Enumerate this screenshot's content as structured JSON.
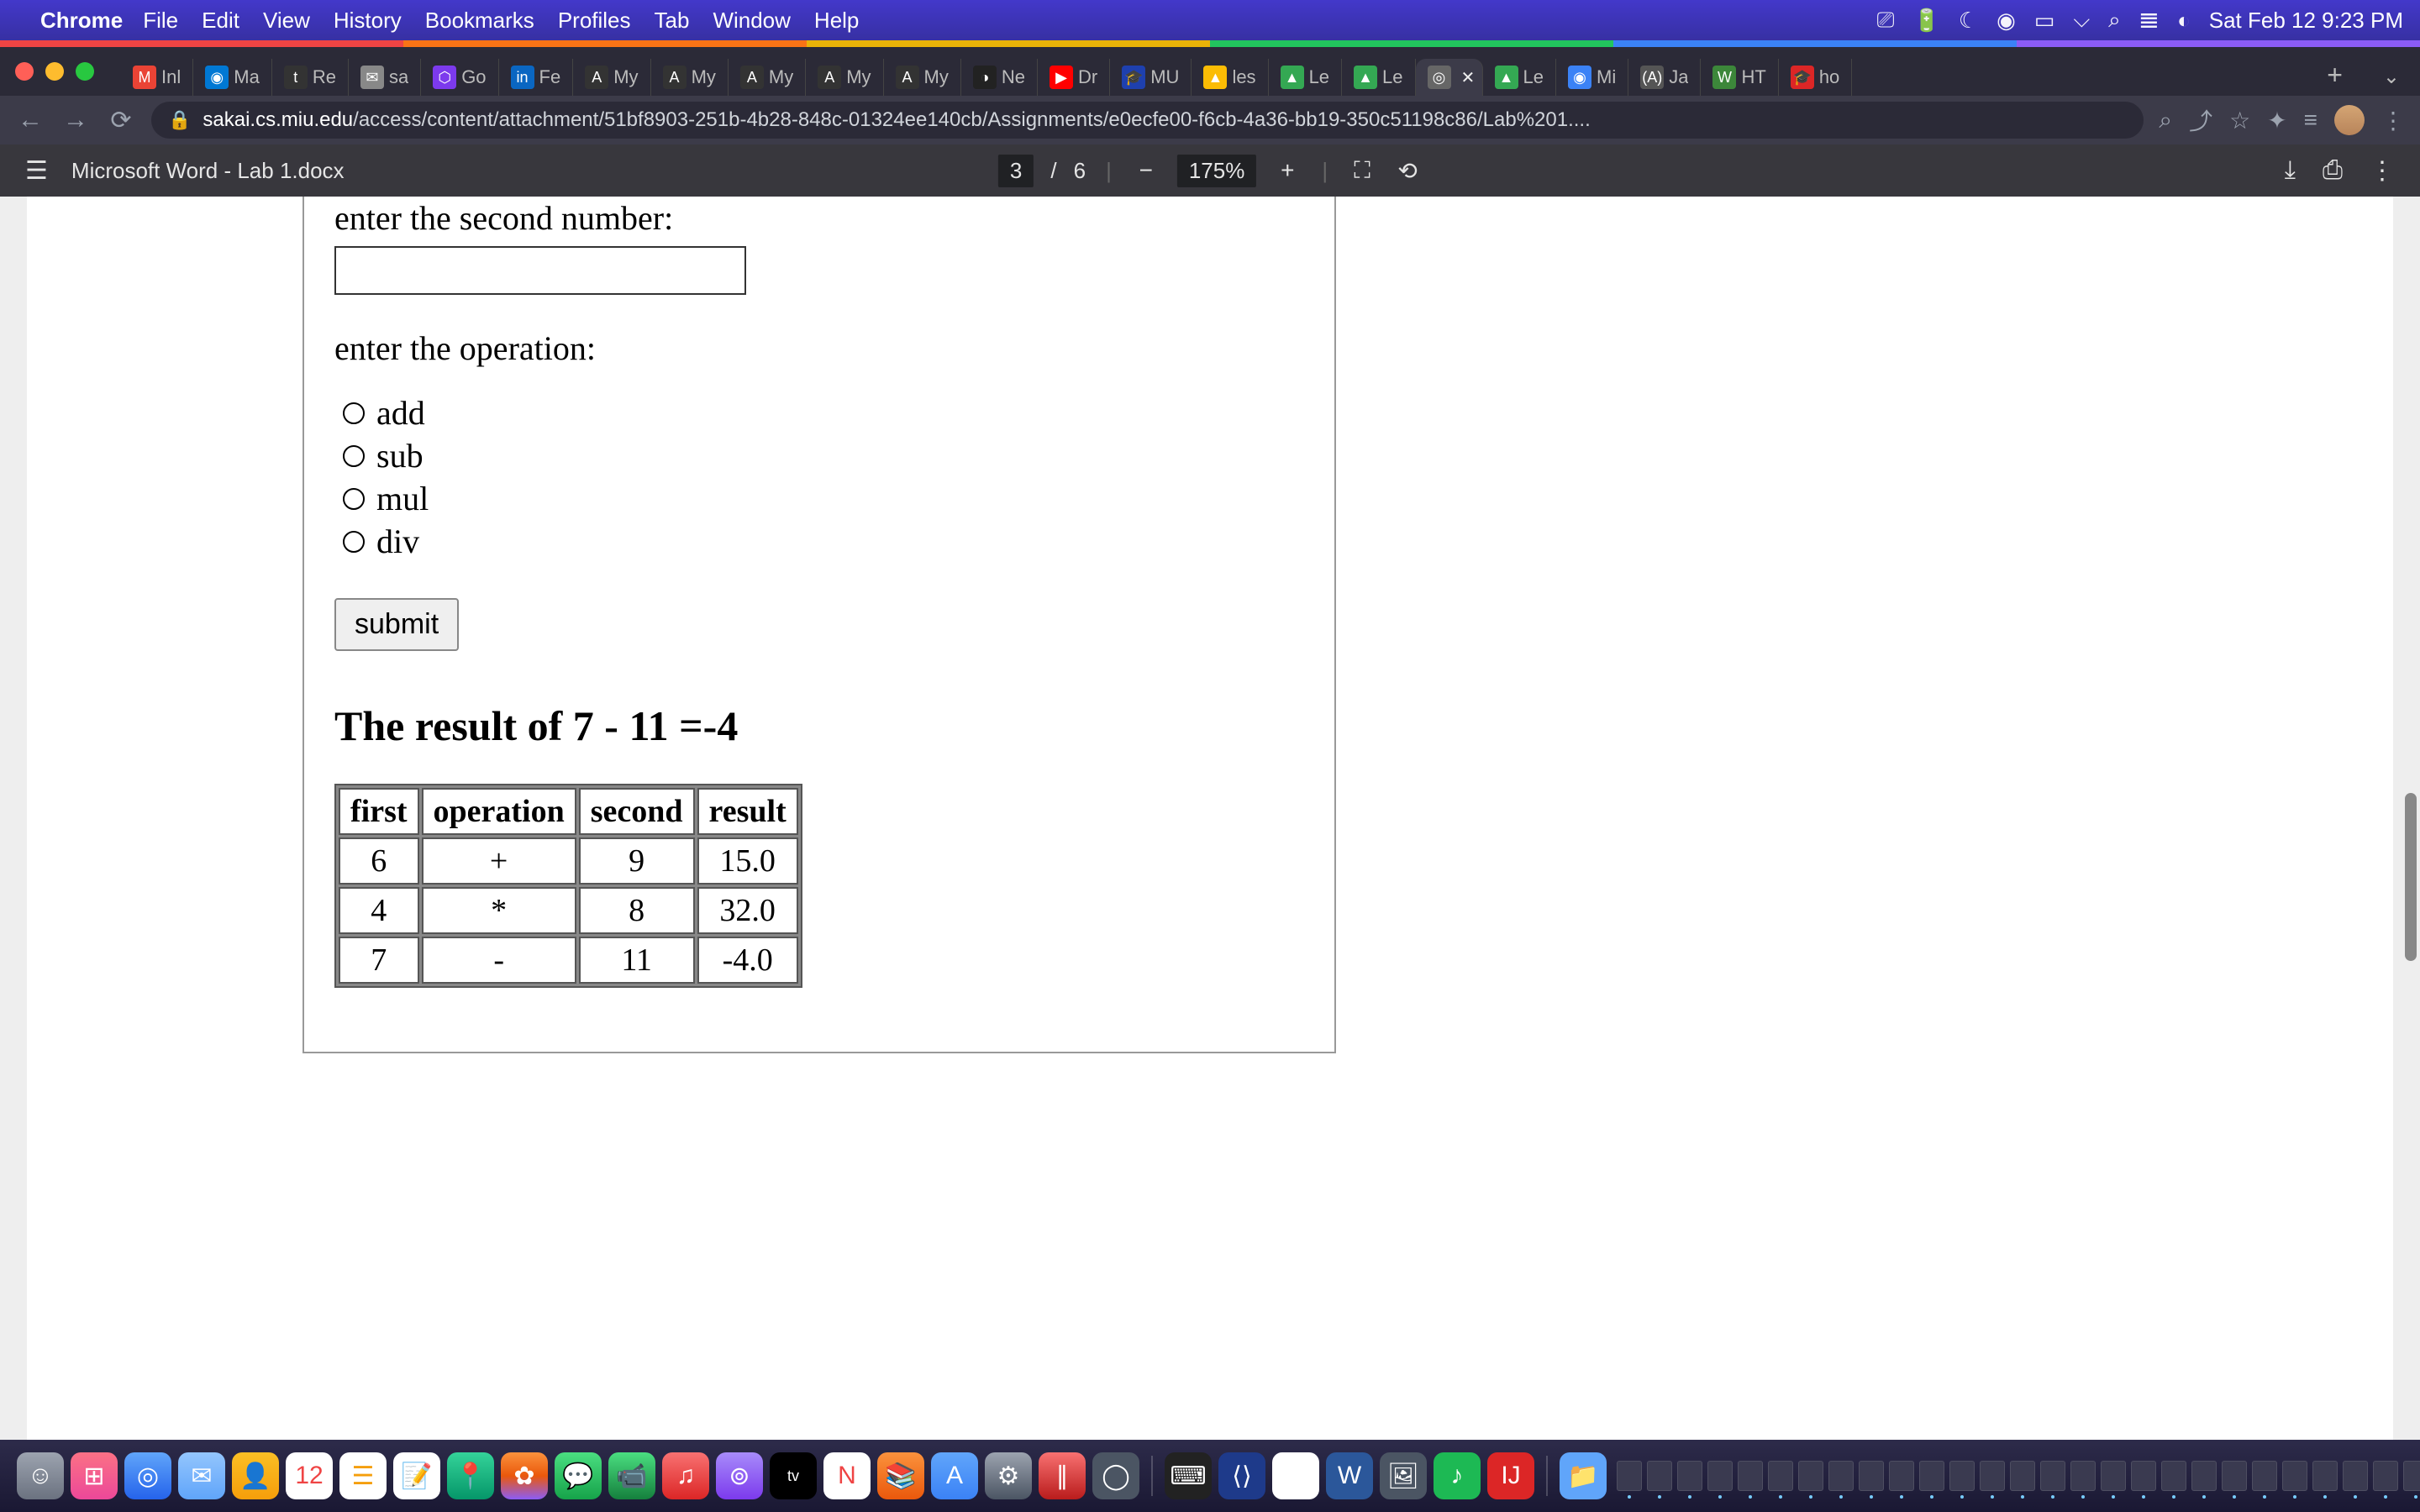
{
  "menubar": {
    "app": "Chrome",
    "items": [
      "File",
      "Edit",
      "View",
      "History",
      "Bookmarks",
      "Profiles",
      "Tab",
      "Window",
      "Help"
    ],
    "datetime": "Sat Feb 12  9:23 PM"
  },
  "tabs": [
    {
      "label": "Inl",
      "fav": "M",
      "color": "#ea4335"
    },
    {
      "label": "Ma",
      "fav": "◉",
      "color": "#0078d4"
    },
    {
      "label": "Re",
      "fav": "t",
      "color": "#333"
    },
    {
      "label": "sa",
      "fav": "✉",
      "color": "#888"
    },
    {
      "label": "Go",
      "fav": "⬡",
      "color": "#7c3aed"
    },
    {
      "label": "Fe",
      "fav": "in",
      "color": "#0a66c2"
    },
    {
      "label": "My",
      "fav": "A",
      "color": "#333"
    },
    {
      "label": "My",
      "fav": "A",
      "color": "#333"
    },
    {
      "label": "My",
      "fav": "A",
      "color": "#333"
    },
    {
      "label": "My",
      "fav": "A",
      "color": "#333"
    },
    {
      "label": "My",
      "fav": "A",
      "color": "#333"
    },
    {
      "label": "Ne",
      "fav": "◑",
      "color": "#222"
    },
    {
      "label": "Dr",
      "fav": "▶",
      "color": "#ff0000"
    },
    {
      "label": "MU",
      "fav": "🎓",
      "color": "#1e40af"
    },
    {
      "label": "les",
      "fav": "▲",
      "color": "#fbbc04"
    },
    {
      "label": "Le",
      "fav": "▲",
      "color": "#34a853"
    },
    {
      "label": "Le",
      "fav": "▲",
      "color": "#34a853"
    },
    {
      "label": "",
      "fav": "◎",
      "color": "#666",
      "active": true
    },
    {
      "label": "Le",
      "fav": "▲",
      "color": "#34a853"
    },
    {
      "label": "Mi",
      "fav": "◉",
      "color": "#3b82f6"
    },
    {
      "label": "Ja",
      "fav": "(A)",
      "color": "#555"
    },
    {
      "label": "HT",
      "fav": "W",
      "color": "#3c873a"
    },
    {
      "label": "ho",
      "fav": "🎓",
      "color": "#dc2626"
    }
  ],
  "url": {
    "domain": "sakai.cs.miu.edu",
    "path": "/access/content/attachment/51bf8903-251b-4b28-848c-01324ee140cb/Assignments/e0ecfe00-f6cb-4a36-bb19-350c51198c86/Lab%201...."
  },
  "pdf": {
    "title": "Microsoft Word - Lab 1.docx",
    "page_current": "3",
    "page_sep": "/",
    "page_total": "6",
    "zoom": "175%"
  },
  "document": {
    "label_second": "enter the second number:",
    "label_operation": "enter the operation:",
    "radios": [
      "add",
      "sub",
      "mul",
      "div"
    ],
    "submit": "submit",
    "result_heading": "The result of 7 - 11 =-4",
    "table": {
      "headers": [
        "first",
        "operation",
        "second",
        "result"
      ],
      "rows": [
        [
          "6",
          "+",
          "9",
          "15.0"
        ],
        [
          "4",
          "*",
          "8",
          "32.0"
        ],
        [
          "7",
          "-",
          "11",
          "-4.0"
        ]
      ]
    }
  }
}
